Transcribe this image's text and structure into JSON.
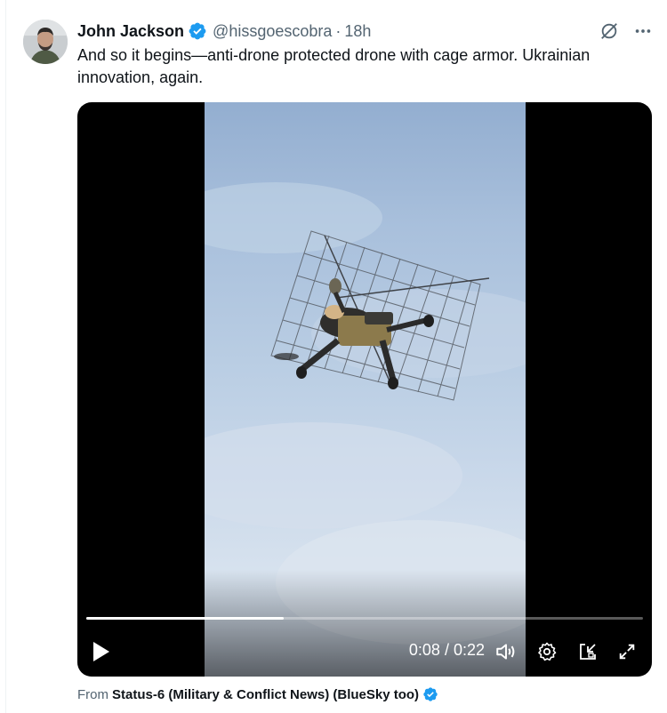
{
  "author": {
    "display_name": "John Jackson",
    "handle": "@hissgoescobra",
    "separator": "·",
    "time": "18h",
    "verified": true
  },
  "tweet": {
    "text": "And so it begins—anti-drone protected drone with cage armor. Ukrainian innovation, again."
  },
  "video": {
    "current_time": "0:08",
    "duration": "0:22",
    "time_separator": " / ",
    "progress_fraction": 0.354
  },
  "source": {
    "prefix": "From",
    "name": "Status-6 (Military & Conflict News) (BlueSky too)",
    "verified": true
  },
  "icons": {
    "top": [
      "grok-icon",
      "more-icon"
    ],
    "controls": [
      "play-icon",
      "volume-icon",
      "settings-icon",
      "pip-icon",
      "fullscreen-icon"
    ]
  },
  "colors": {
    "verified_blue": "#1d9bf0",
    "text_primary": "#0f1419",
    "text_secondary": "#536471"
  }
}
